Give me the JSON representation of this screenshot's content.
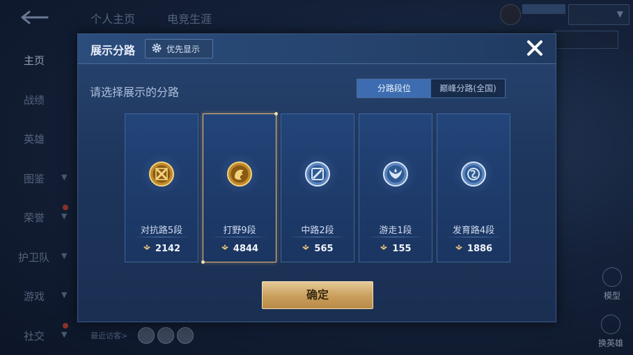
{
  "top_tabs": [
    "个人主页",
    "电竞生涯"
  ],
  "top_tag": "",
  "data_button": "",
  "sidebar": [
    {
      "label": "主页",
      "active": true,
      "chevron": false,
      "dot": false
    },
    {
      "label": "战绩",
      "active": false,
      "chevron": false,
      "dot": false
    },
    {
      "label": "英雄",
      "active": false,
      "chevron": false,
      "dot": false
    },
    {
      "label": "图鉴",
      "active": false,
      "chevron": true,
      "dot": false
    },
    {
      "label": "荣誉",
      "active": false,
      "chevron": true,
      "dot": true
    },
    {
      "label": "护卫队",
      "active": false,
      "chevron": true,
      "dot": false
    },
    {
      "label": "游戏",
      "active": false,
      "chevron": true,
      "dot": false
    },
    {
      "label": "社交",
      "active": false,
      "chevron": true,
      "dot": true
    }
  ],
  "visitors_label": "最近访客>",
  "right_buttons": [
    "模型",
    "换英雄"
  ],
  "modal": {
    "title": "展示分路",
    "priority_label": "优先显示",
    "subtitle": "请选择展示的分路",
    "segments": [
      "分路段位",
      "巅峰分路(全国)"
    ],
    "active_segment": 0,
    "confirm_label": "确定",
    "accent_gold": "#e6b872",
    "cards": [
      {
        "rank": "对抗路5段",
        "score": "2142",
        "icon": "clash-lane-icon",
        "tier": "gold",
        "selected": false
      },
      {
        "rank": "打野9段",
        "score": "4844",
        "icon": "jungle-dragon-icon",
        "tier": "gold",
        "selected": true
      },
      {
        "rank": "中路2段",
        "score": "565",
        "icon": "mid-lane-icon",
        "tier": "silver",
        "selected": false
      },
      {
        "rank": "游走1段",
        "score": "155",
        "icon": "roam-wings-icon",
        "tier": "silver",
        "selected": false
      },
      {
        "rank": "发育路4段",
        "score": "1886",
        "icon": "farm-lane-icon",
        "tier": "silver",
        "selected": false
      }
    ]
  }
}
